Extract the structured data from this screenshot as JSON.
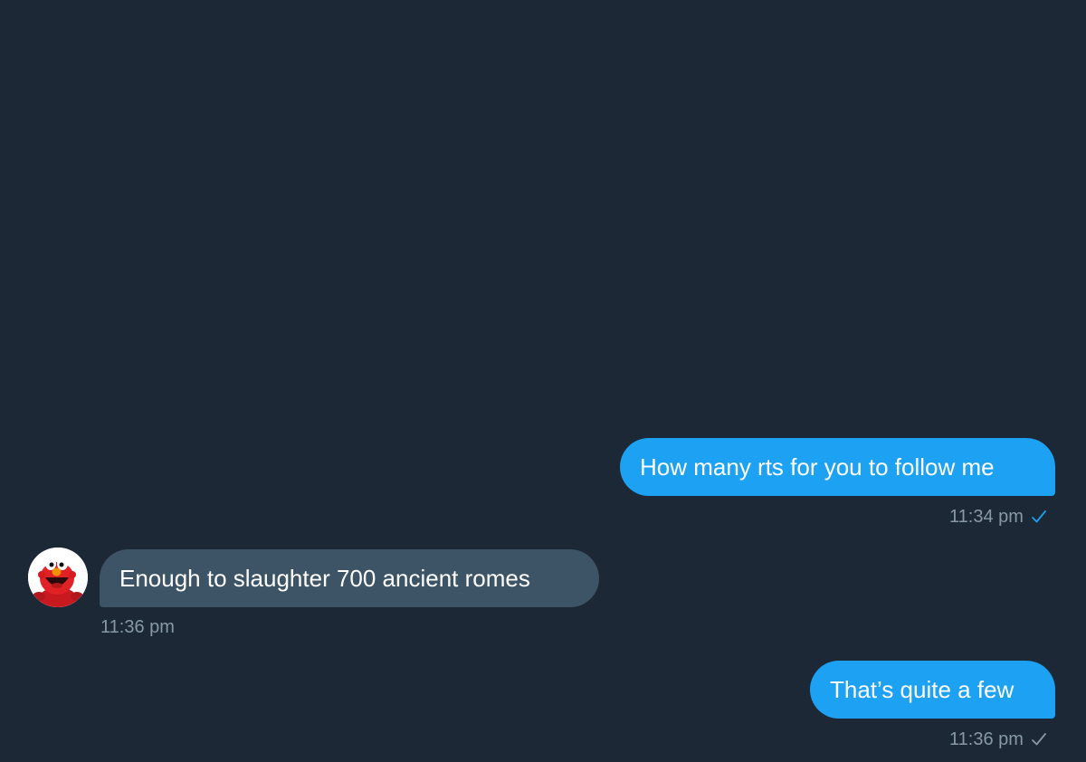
{
  "colors": {
    "background": "#1c2836",
    "sent_bubble": "#1da1f2",
    "received_bubble": "#3d5466",
    "timestamp": "#8899a6",
    "read_check": "#1da1f2"
  },
  "messages": [
    {
      "direction": "sent",
      "text": "How many rts for you to follow me",
      "time": "11:34 pm",
      "status_icon": "read-check-icon"
    },
    {
      "direction": "received",
      "text": "Enough to slaughter 700 ancient romes",
      "time": "11:36 pm",
      "avatar_icon": "elmo-avatar"
    },
    {
      "direction": "sent",
      "text": "That’s quite a few",
      "time": "11:36 pm",
      "status_icon": "sent-check-icon"
    }
  ]
}
